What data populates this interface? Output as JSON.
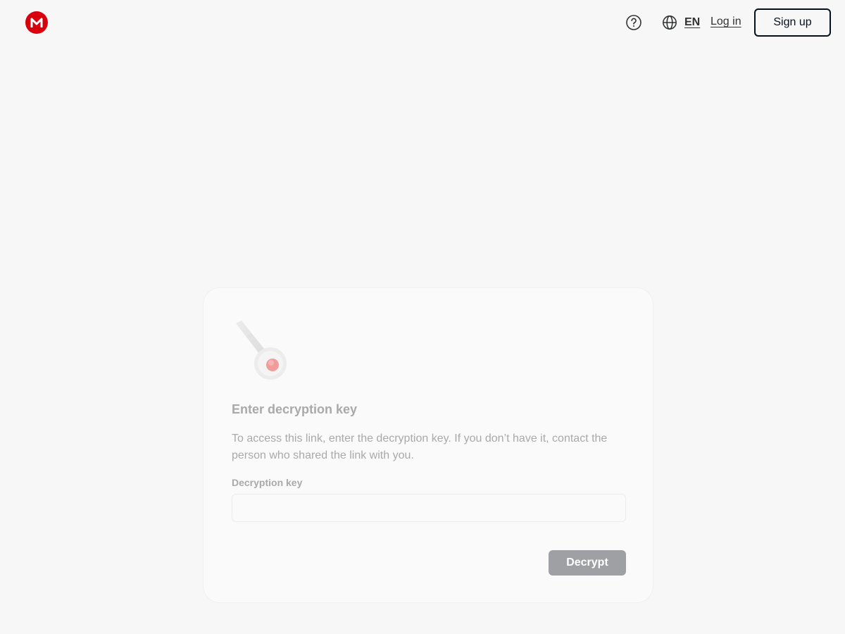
{
  "header": {
    "logo_icon": "mega-logo-icon",
    "help_icon": "help-circle-icon",
    "language": {
      "icon": "globe-icon",
      "label": "EN"
    },
    "login_label": "Log in",
    "signup_label": "Sign up"
  },
  "card": {
    "illustration": "key-icon",
    "title": "Enter decryption key",
    "description": "To access this link, enter the decryption key. If you don’t have it, contact the person who shared the link with you.",
    "field_label": "Decryption key",
    "input": {
      "value": "",
      "placeholder": ""
    },
    "decrypt_label": "Decrypt"
  },
  "colors": {
    "brand": "#d9000d",
    "background": "#f7f7f7",
    "card": "#fafafa",
    "button_disabled": "#9fa0a4",
    "text_primary": "#303233",
    "text_muted": "#a9a9a9",
    "signup_border": "#04101e"
  }
}
